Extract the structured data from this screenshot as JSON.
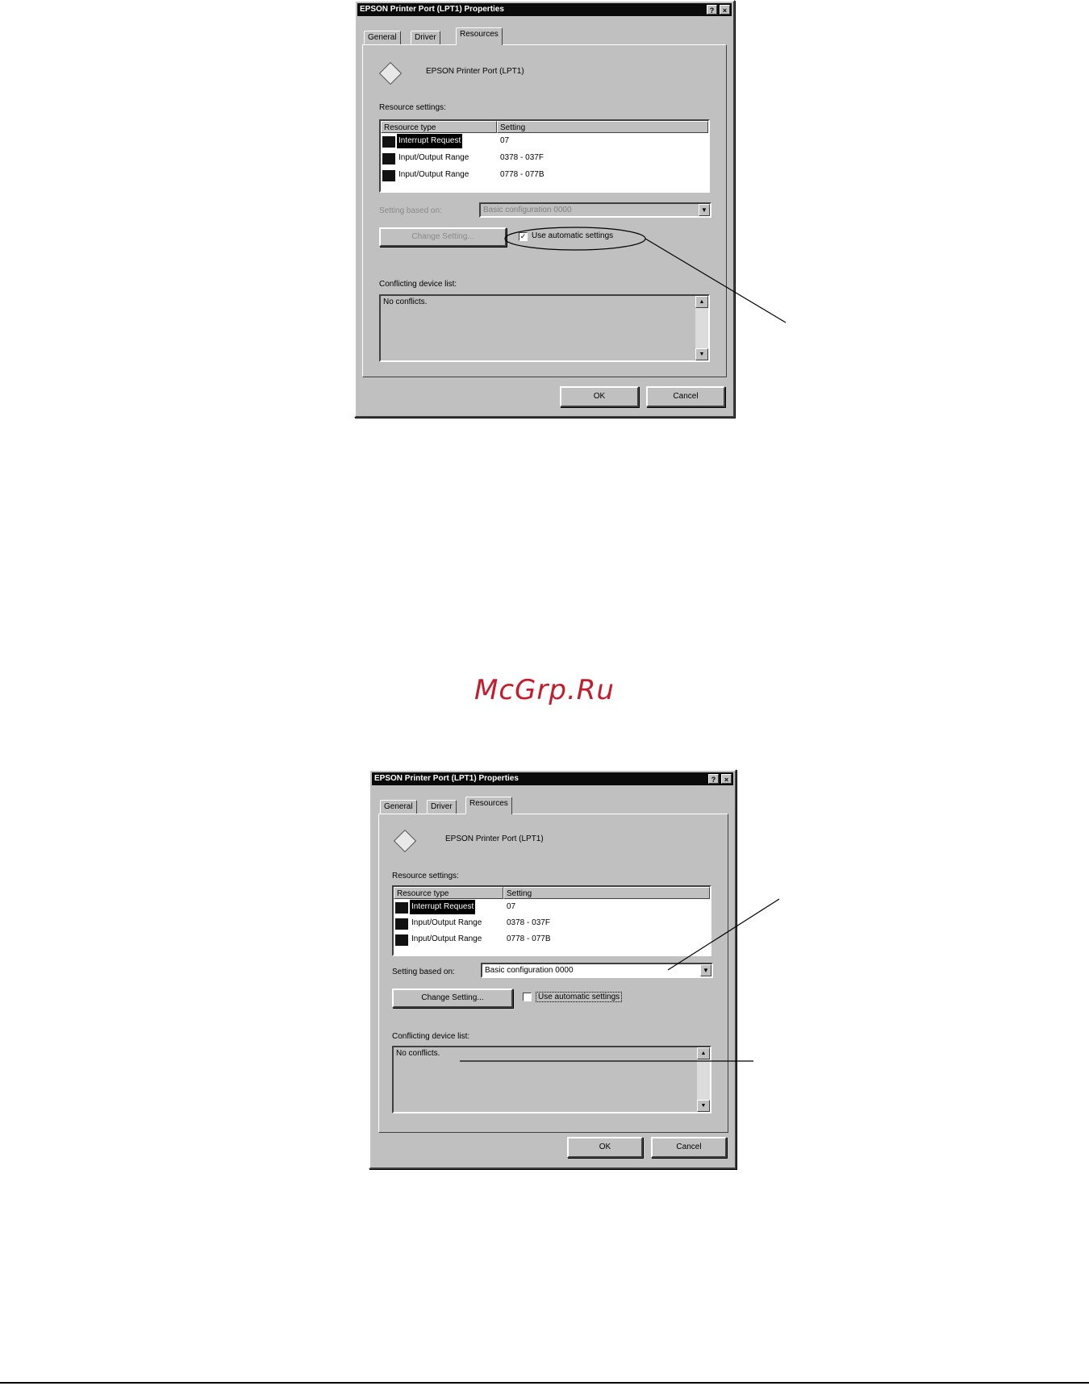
{
  "dialog1": {
    "title": "EPSON Printer Port (LPT1) Properties",
    "help_btn": "?",
    "close_btn": "×",
    "tabs": [
      "General",
      "Driver",
      "Resources"
    ],
    "device_name": "EPSON Printer Port (LPT1)",
    "resource_settings_label": "Resource settings:",
    "columns": [
      "Resource type",
      "Setting"
    ],
    "rows": [
      {
        "type": "Interrupt Request",
        "setting": "07"
      },
      {
        "type": "Input/Output Range",
        "setting": "0378 - 037F"
      },
      {
        "type": "Input/Output Range",
        "setting": "0778 - 077B"
      }
    ],
    "setting_based_on_label": "Setting based on:",
    "setting_based_on_value": "Basic configuration 0000",
    "change_setting_btn": "Change Setting...",
    "use_auto_label": "Use automatic settings",
    "use_auto_checked": true,
    "conflict_label": "Conflicting device list:",
    "conflict_value": "No conflicts.",
    "ok_btn": "OK",
    "cancel_btn": "Cancel"
  },
  "dialog2": {
    "title": "EPSON Printer Port (LPT1) Properties",
    "help_btn": "?",
    "close_btn": "×",
    "tabs": [
      "General",
      "Driver",
      "Resources"
    ],
    "device_name": "EPSON Printer Port (LPT1)",
    "resource_settings_label": "Resource settings:",
    "columns": [
      "Resource type",
      "Setting"
    ],
    "rows": [
      {
        "type": "Interrupt Request",
        "setting": "07"
      },
      {
        "type": "Input/Output Range",
        "setting": "0378 - 037F"
      },
      {
        "type": "Input/Output Range",
        "setting": "0778 - 077B"
      }
    ],
    "setting_based_on_label": "Setting based on:",
    "setting_based_on_value": "Basic configuration 0000",
    "change_setting_btn": "Change Setting...",
    "use_auto_label": "Use automatic settings",
    "use_auto_checked": false,
    "conflict_label": "Conflicting device list:",
    "conflict_value": "No conflicts.",
    "ok_btn": "OK",
    "cancel_btn": "Cancel"
  },
  "watermark": "McGrp.Ru",
  "colors": {
    "watermark": "#c41c2c",
    "dialog_bg": "#c0c0c0",
    "titlebar": "#0a0a0a"
  }
}
